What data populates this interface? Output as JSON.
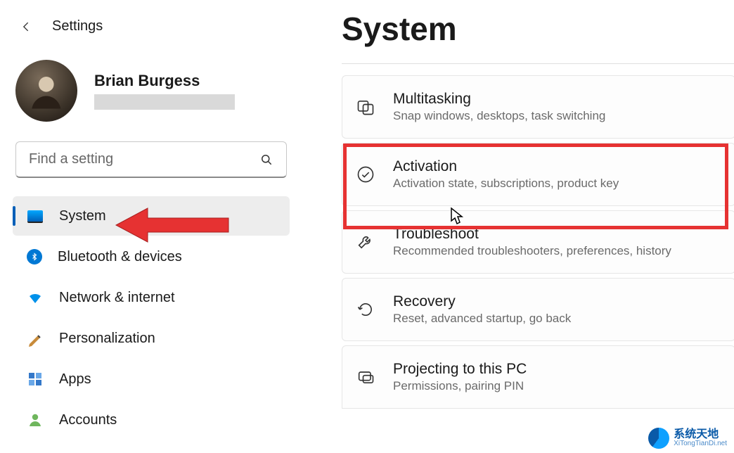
{
  "header": {
    "back_label": "Settings"
  },
  "user": {
    "name": "Brian Burgess"
  },
  "search": {
    "placeholder": "Find a setting"
  },
  "nav": {
    "items": [
      {
        "label": "System"
      },
      {
        "label": "Bluetooth & devices"
      },
      {
        "label": "Network & internet"
      },
      {
        "label": "Personalization"
      },
      {
        "label": "Apps"
      },
      {
        "label": "Accounts"
      }
    ]
  },
  "page": {
    "title": "System"
  },
  "cards": [
    {
      "title": "Multitasking",
      "desc": "Snap windows, desktops, task switching"
    },
    {
      "title": "Activation",
      "desc": "Activation state, subscriptions, product key"
    },
    {
      "title": "Troubleshoot",
      "desc": "Recommended troubleshooters, preferences, history"
    },
    {
      "title": "Recovery",
      "desc": "Reset, advanced startup, go back"
    },
    {
      "title": "Projecting to this PC",
      "desc": "Permissions, pairing PIN"
    }
  ],
  "watermark": {
    "cn": "系统天地",
    "en": "XiTongTianDi.net"
  }
}
